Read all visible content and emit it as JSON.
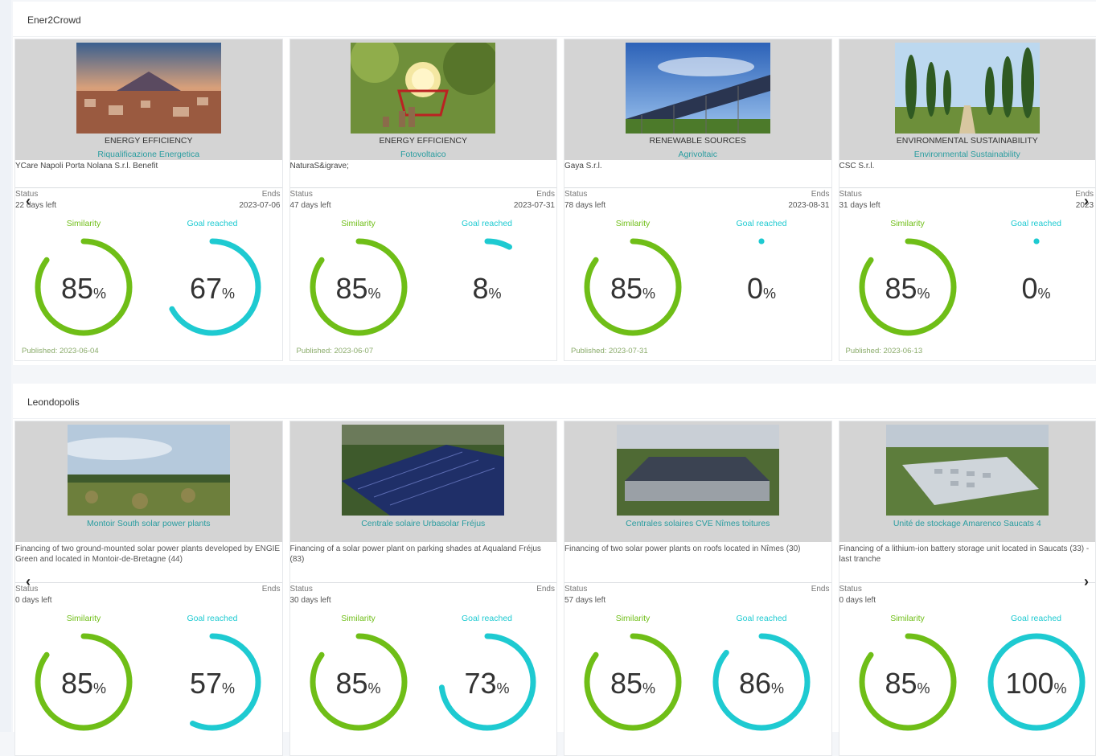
{
  "sections": [
    {
      "title": "Ener2Crowd",
      "cards": [
        {
          "category": "ENERGY EFFICIENCY",
          "subtitle": "Riqualificazione Energetica",
          "company": "YCare Napoli Porta Nolana S.r.l. Benefit",
          "status_label": "Status",
          "days_left": "22 days left",
          "ends_label": "Ends",
          "ends_date": "2023-07-06",
          "similarity_label": "Similarity",
          "similarity_value": "85",
          "goal_label": "Goal reached",
          "goal_value": "67",
          "unit": "%",
          "published": "Published: 2023-06-04",
          "similarity_fraction": 0.85,
          "goal_fraction": 0.67,
          "image": "naples-city-photo"
        },
        {
          "category": "ENERGY EFFICIENCY",
          "subtitle": "Fotovoltaico",
          "company": "NaturaS&igrave;",
          "status_label": "Status",
          "days_left": "47 days left",
          "ends_label": "Ends",
          "ends_date": "2023-07-31",
          "similarity_label": "Similarity",
          "similarity_value": "85",
          "goal_label": "Goal reached",
          "goal_value": "8",
          "unit": "%",
          "published": "Published: 2023-06-07",
          "similarity_fraction": 0.85,
          "goal_fraction": 0.08,
          "image": "lightbulb-cart-photo"
        },
        {
          "category": "RENEWABLE SOURCES",
          "subtitle": "Agrivoltaic",
          "company": "Gaya S.r.l.",
          "status_label": "Status",
          "days_left": "78 days left",
          "ends_label": "Ends",
          "ends_date": "2023-08-31",
          "similarity_label": "Similarity",
          "similarity_value": "85",
          "goal_label": "Goal reached",
          "goal_value": "0",
          "unit": "%",
          "published": "Published: 2023-07-31",
          "similarity_fraction": 0.85,
          "goal_fraction": 0,
          "image": "agrivoltaic-panels-photo"
        },
        {
          "category": "ENVIRONMENTAL SUSTAINABILITY",
          "subtitle": "Environmental Sustainability",
          "company": "CSC S.r.l.",
          "status_label": "Status",
          "days_left": "31 days left",
          "ends_label": "Ends",
          "ends_date": "2023",
          "similarity_label": "Similarity",
          "similarity_value": "85",
          "goal_label": "Goal reached",
          "goal_value": "0",
          "unit": "%",
          "published": "Published: 2023-06-13",
          "similarity_fraction": 0.85,
          "goal_fraction": 0,
          "image": "cypress-trees-photo"
        }
      ]
    },
    {
      "title": "Leondopolis",
      "cards": [
        {
          "subtitle": "Montoir South solar power plants",
          "description": "Financing of two ground-mounted solar power plants developed by ENGIE Green and located in Montoir-de-Bretagne (44)",
          "status_label": "Status",
          "days_left": "0 days left",
          "ends_label": "Ends",
          "similarity_label": "Similarity",
          "similarity_value": "85",
          "goal_label": "Goal reached",
          "goal_value": "57",
          "unit": "%",
          "similarity_fraction": 0.85,
          "goal_fraction": 0.57,
          "image": "field-solar-photo"
        },
        {
          "subtitle": "Centrale solaire Urbasolar Fréjus",
          "description": "Financing of a solar power plant on parking shades at Aqualand Fréjus (83)",
          "status_label": "Status",
          "days_left": "30 days left",
          "ends_label": "Ends",
          "similarity_label": "Similarity",
          "similarity_value": "85",
          "goal_label": "Goal reached",
          "goal_value": "73",
          "unit": "%",
          "similarity_fraction": 0.85,
          "goal_fraction": 0.73,
          "image": "parking-solar-photo"
        },
        {
          "subtitle": "Centrales solaires CVE Nîmes toitures",
          "description": "Financing of two solar power plants on roofs located in Nîmes (30)",
          "status_label": "Status",
          "days_left": "57 days left",
          "ends_label": "Ends",
          "similarity_label": "Similarity",
          "similarity_value": "85",
          "goal_label": "Goal reached",
          "goal_value": "86",
          "unit": "%",
          "similarity_fraction": 0.85,
          "goal_fraction": 0.86,
          "image": "roof-solar-photo"
        },
        {
          "subtitle": "Unité de stockage Amarenco Saucats 4",
          "description": "Financing of a lithium-ion battery storage unit located in Saucats (33) - last tranche",
          "status_label": "Status",
          "days_left": "0 days left",
          "ends_label": "",
          "similarity_label": "Similarity",
          "similarity_value": "85",
          "goal_label": "Goal reached",
          "goal_value": "100",
          "unit": "%",
          "similarity_fraction": 0.85,
          "goal_fraction": 1,
          "image": "battery-storage-photo"
        }
      ]
    }
  ],
  "colors": {
    "similarity": "#6fbe17",
    "goal": "#1ecad1",
    "subtitle": "#2a9da0"
  },
  "icons": {
    "prev": "chevron-left-icon",
    "next": "chevron-right-icon"
  }
}
